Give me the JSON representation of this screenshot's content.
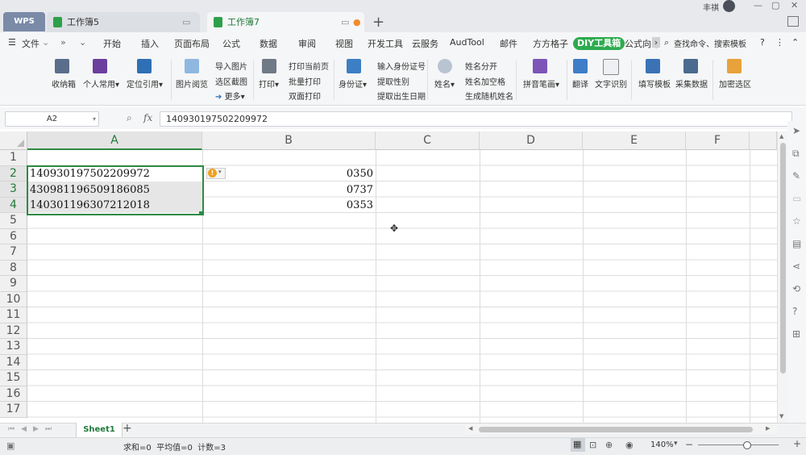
{
  "tabbar": {
    "app_label": "WPS",
    "tabs": [
      {
        "label": "工作簿5",
        "active": false
      },
      {
        "label": "工作簿7",
        "active": true
      }
    ],
    "user_name": "丰祺"
  },
  "menu": {
    "file_label": "文件",
    "items": [
      "开始",
      "插入",
      "页面布局",
      "公式",
      "数据",
      "审阅",
      "视图",
      "开发工具",
      "云服务",
      "AudTool",
      "邮件",
      "方方格子",
      "DIY工具箱",
      "公式向导"
    ],
    "search_label": "查找命令、搜索模板"
  },
  "ribbon": {
    "buttons": {
      "shoudaoxiang": "收纳箱",
      "personal": "个人常用",
      "locate": "定位引用",
      "image_view": "图片阅览",
      "import_image": "导入图片",
      "range_shot": "选区截图",
      "more": "更多",
      "print": "打印",
      "print_current": "打印当前页",
      "batch_print": "批量打印",
      "duplex_print": "双面打印",
      "id_card": "身份证",
      "input_id": "输入身份证号",
      "extract_gender": "提取性别",
      "extract_birth": "提取出生日期",
      "name": "姓名",
      "name_split": "姓名分开",
      "name_space": "姓名加空格",
      "random_name": "生成随机姓名",
      "pinyin": "拼音笔画",
      "translate": "翻译",
      "ocr": "文字识别",
      "fill_template": "填写模板",
      "collect_data": "采集数据",
      "encrypt_range": "加密选区"
    }
  },
  "formula_bar": {
    "name_box": "A2",
    "fx_label": "fx",
    "value": "140930197502209972"
  },
  "sheet": {
    "columns": [
      "A",
      "B",
      "C",
      "D",
      "E",
      "F"
    ],
    "rows": [
      "1",
      "2",
      "3",
      "4",
      "5",
      "6",
      "7",
      "8",
      "9",
      "10",
      "11",
      "12",
      "13",
      "14",
      "15",
      "16",
      "17"
    ],
    "col_a": [
      "140930197502209972",
      "430981196509186085",
      "140301196307212018"
    ],
    "col_b": [
      "0350",
      "0737",
      "0353"
    ]
  },
  "sheet_tabs": {
    "active": "Sheet1"
  },
  "status": {
    "summary": "求和=0  平均值=0  计数=3",
    "zoom": "140%"
  },
  "colors": {
    "accent": "#2dab4e",
    "selection": "#2e8a43"
  }
}
